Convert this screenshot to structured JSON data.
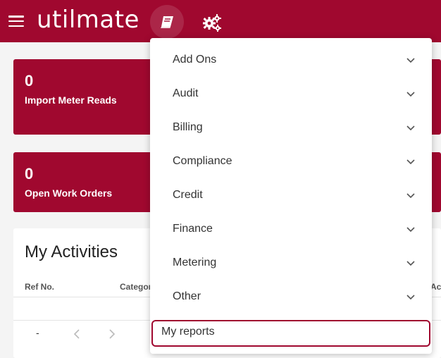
{
  "header": {
    "brand": "utilmate",
    "menu_icon": "hamburger-icon",
    "reports_icon": "book-icon",
    "settings_icon": "gears-icon"
  },
  "cards": [
    {
      "value": "0",
      "label": "Import Meter Reads"
    },
    {
      "value": "0",
      "label": "Open Work Orders"
    }
  ],
  "activities": {
    "title": "My Activities",
    "columns": [
      "Ref No.",
      "Category",
      "Acc"
    ],
    "pager": {
      "range": "-"
    }
  },
  "reports_menu": {
    "items": [
      {
        "label": "Add Ons"
      },
      {
        "label": "Audit"
      },
      {
        "label": "Billing"
      },
      {
        "label": "Compliance"
      },
      {
        "label": "Credit"
      },
      {
        "label": "Finance"
      },
      {
        "label": "Metering"
      },
      {
        "label": "Other"
      }
    ],
    "selected": "My reports"
  },
  "colors": {
    "brand": "#a0082f"
  }
}
